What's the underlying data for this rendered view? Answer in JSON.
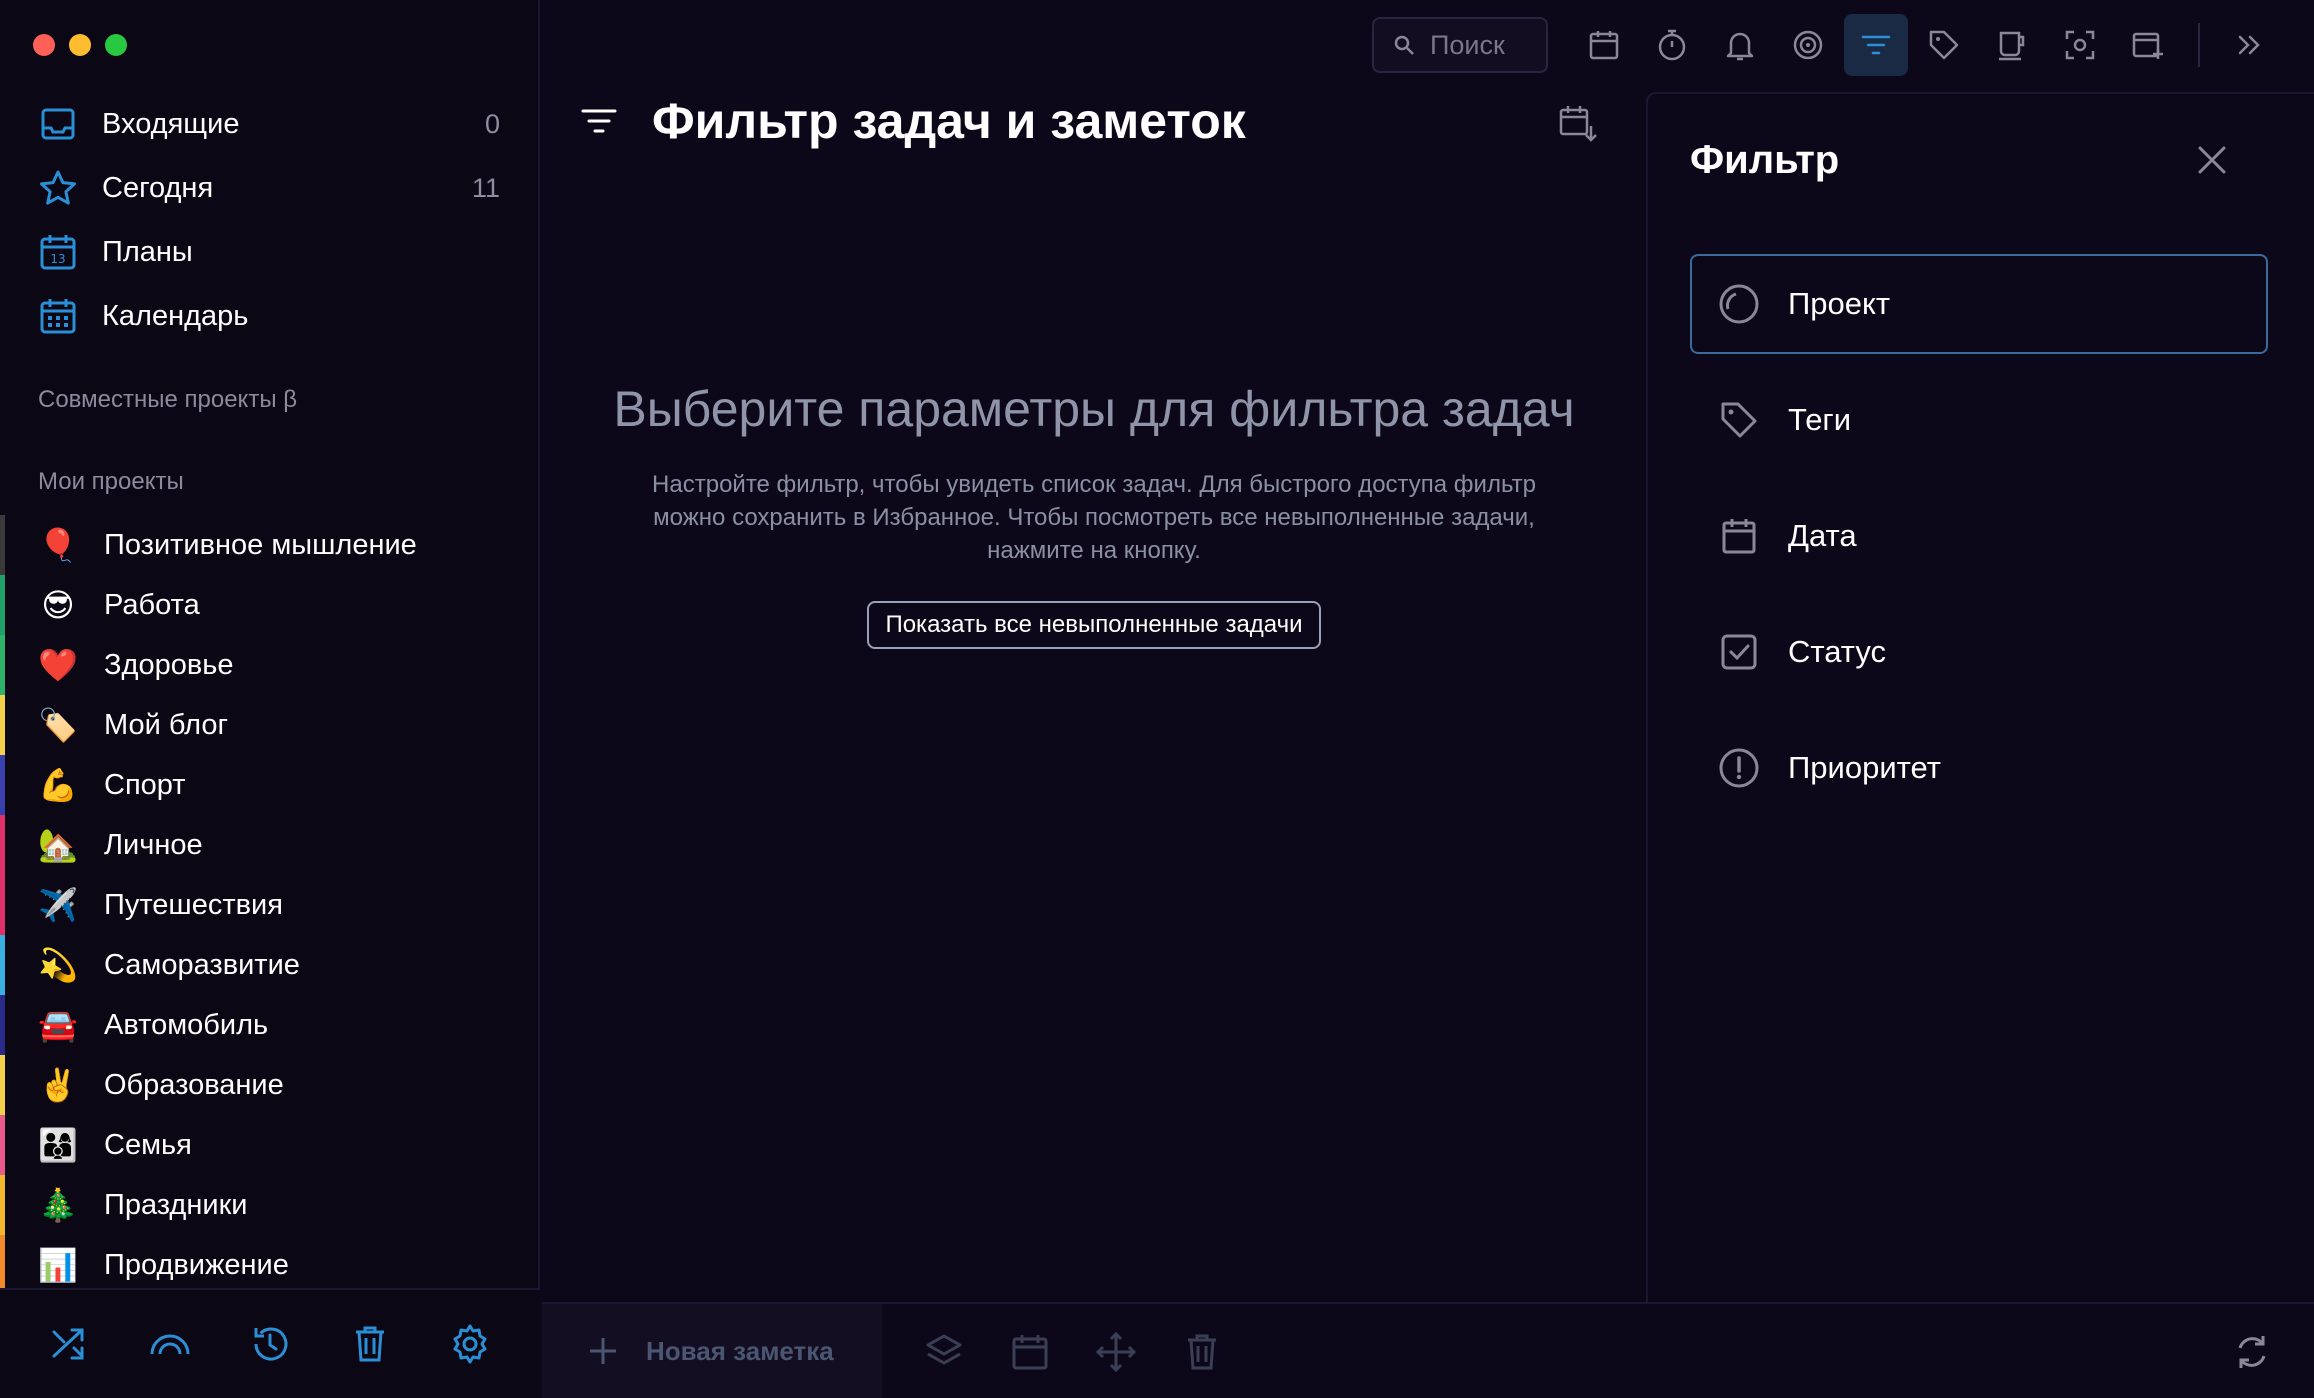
{
  "window": {
    "controls": [
      "close",
      "minimize",
      "zoom"
    ]
  },
  "sidebar": {
    "nav": [
      {
        "label": "Входящие",
        "count": "0",
        "icon": "inbox-icon"
      },
      {
        "label": "Сегодня",
        "count": "11",
        "icon": "star-icon"
      },
      {
        "label": "Планы",
        "count": "",
        "icon": "calendar-13-icon"
      },
      {
        "label": "Календарь",
        "count": "",
        "icon": "calendar-grid-icon"
      }
    ],
    "shared_title": "Совместные проекты β",
    "projects_title": "Мои проекты",
    "projects": [
      {
        "emoji": "🎈",
        "label": "Позитивное мышление",
        "color": "#3a3a3a"
      },
      {
        "emoji": "😎",
        "label": "Работа",
        "color": "#22a06b"
      },
      {
        "emoji": "❤️",
        "label": "Здоровье",
        "color": "#2fb36a"
      },
      {
        "emoji": "🏷️",
        "label": "Мой блог",
        "color": "#f2d24b"
      },
      {
        "emoji": "💪",
        "label": "Спорт",
        "color": "#3a3fb0"
      },
      {
        "emoji": "🏡",
        "label": "Личное",
        "color": "#e0306a"
      },
      {
        "emoji": "✈️",
        "label": "Путешествия",
        "color": "#e0306a"
      },
      {
        "emoji": "💫",
        "label": "Саморазвитие",
        "color": "#3ab0e0"
      },
      {
        "emoji": "🚘",
        "label": "Автомобиль",
        "color": "#2a2a8a"
      },
      {
        "emoji": "✌️",
        "label": "Образование",
        "color": "#f2d24b"
      },
      {
        "emoji": "👨‍👩‍👦",
        "label": "Семья",
        "color": "#e85a8a"
      },
      {
        "emoji": "🎄",
        "label": "Праздники",
        "color": "#f2b82b"
      },
      {
        "emoji": "📊",
        "label": "Продвижение",
        "color": "#f28a2b"
      }
    ],
    "bottom_icons": [
      "shuffle-icon",
      "rainbow-icon",
      "history-icon",
      "trash-icon",
      "settings-icon"
    ]
  },
  "toolbar": {
    "search_placeholder": "Поиск",
    "icons": [
      "calendar-icon",
      "timer-icon",
      "bell-icon",
      "focus-icon",
      "filter-icon",
      "tag-icon",
      "coffee-icon",
      "scan-icon",
      "add-calendar-icon",
      "expand-icon"
    ],
    "active": "filter-icon"
  },
  "main": {
    "title": "Фильтр задач и заметок",
    "empty_title": "Выберите параметры для фильтра задач",
    "empty_desc": "Настройте фильтр, чтобы увидеть список задач. Для быстрого доступа фильтр можно сохранить в Избранное. Чтобы посмотреть все невыполненные задачи, нажмите на кнопку.",
    "show_button": "Показать все невыполненные задачи",
    "new_note": "Новая заметка"
  },
  "filter_panel": {
    "title": "Фильтр",
    "items": [
      {
        "label": "Проект",
        "icon": "project-circle-icon",
        "selected": true
      },
      {
        "label": "Теги",
        "icon": "tag-icon",
        "selected": false
      },
      {
        "label": "Дата",
        "icon": "calendar-icon",
        "selected": false
      },
      {
        "label": "Статус",
        "icon": "checkbox-icon",
        "selected": false
      },
      {
        "label": "Приоритет",
        "icon": "priority-icon",
        "selected": false
      }
    ]
  },
  "colors": {
    "background": "#0d0819",
    "accent": "#2b8fd6",
    "selected_border": "#3a6b9a"
  }
}
